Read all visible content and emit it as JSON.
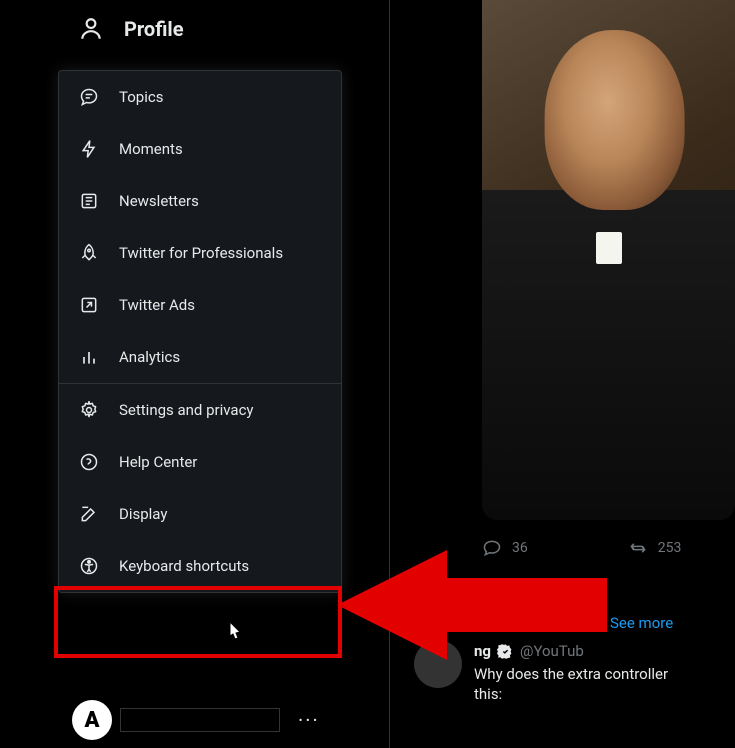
{
  "nav": {
    "profile_label": "Profile"
  },
  "more_menu": {
    "items": [
      {
        "id": "topics",
        "label": "Topics"
      },
      {
        "id": "moments",
        "label": "Moments"
      },
      {
        "id": "newsletters",
        "label": "Newsletters"
      },
      {
        "id": "professionals",
        "label": "Twitter for Professionals"
      },
      {
        "id": "ads",
        "label": "Twitter Ads"
      },
      {
        "id": "analytics",
        "label": "Analytics"
      }
    ],
    "items2": [
      {
        "id": "settings",
        "label": "Settings and privacy"
      },
      {
        "id": "help",
        "label": "Help Center"
      },
      {
        "id": "display",
        "label": "Display"
      },
      {
        "id": "keyboard",
        "label": "Keyboard shortcuts"
      }
    ]
  },
  "post": {
    "actions": {
      "reply_count": "36",
      "retweet_count": "253"
    },
    "see_more_label": "See more"
  },
  "post2": {
    "name_suffix": "ng",
    "handle": "@YouTub",
    "text_line1": "Why does the extra controller",
    "text_line2": "this:"
  },
  "colors": {
    "accent": "#1d9bf0",
    "highlight": "#e30000",
    "background": "#000000",
    "menu_bg": "#15181c"
  }
}
